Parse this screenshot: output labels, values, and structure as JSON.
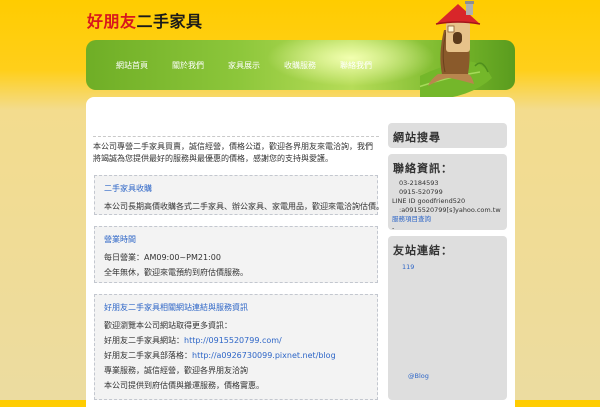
{
  "site": {
    "title_red": "好朋友",
    "title_black": "二手家具"
  },
  "nav": {
    "items": [
      {
        "label": "網站首頁"
      },
      {
        "label": "關於我們"
      },
      {
        "label": "家具展示"
      },
      {
        "label": "收購服務"
      },
      {
        "label": "聯絡我們"
      }
    ]
  },
  "main": {
    "intro": "本公司專營二手家具買賣，誠信經營，價格公道，歡迎各界朋友來電洽詢，我們將竭誠為您提供最好的服務與最優惠的價格，感謝您的支持與愛護。",
    "boxes": [
      {
        "title": "二手家具收購",
        "lines": [
          "本公司長期高價收購各式二手家具、辦公家具、家電用品，歡迎來電洽詢估價。"
        ]
      },
      {
        "title": "營業時間",
        "lines": [
          "每日營業：AM09:00~PM21:00",
          "全年無休，歡迎來電預約到府估價服務。"
        ]
      },
      {
        "title": "好朋友二手家具相關網站連結與服務資訊",
        "lines": [
          {
            "text": "歡迎瀏覽本公司網站取得更多資訊："
          },
          {
            "prefix": "好朋友二手家具網站：",
            "link": "http://0915520799.com/"
          },
          {
            "prefix": "好朋友二手家具部落格：",
            "link": "http://a0926730099.pixnet.net/blog"
          },
          {
            "text": "專業服務，誠信經營，歡迎各界朋友洽詢"
          },
          {
            "text": "本公司提供到府估價與搬運服務，價格實惠。"
          }
        ]
      }
    ]
  },
  "sidebar": {
    "search_title": "網站搜尋",
    "contact": {
      "title": "聯絡資訊：",
      "lines": [
        "03-2184593",
        "0915-520799",
        "LINE ID goodfriend520",
        ":a0915520799[s]yahoo.com.tw"
      ],
      "link": "服務項目查詢",
      "extra": "-"
    },
    "links": {
      "title": "友站連結：",
      "item": "119",
      "footer": "@Blog"
    }
  },
  "colors": {
    "accent_red": "#d8161d",
    "link_blue": "#2e66c7",
    "nav_green": "#8cc63a",
    "background_yellow": "#ffcc00"
  }
}
